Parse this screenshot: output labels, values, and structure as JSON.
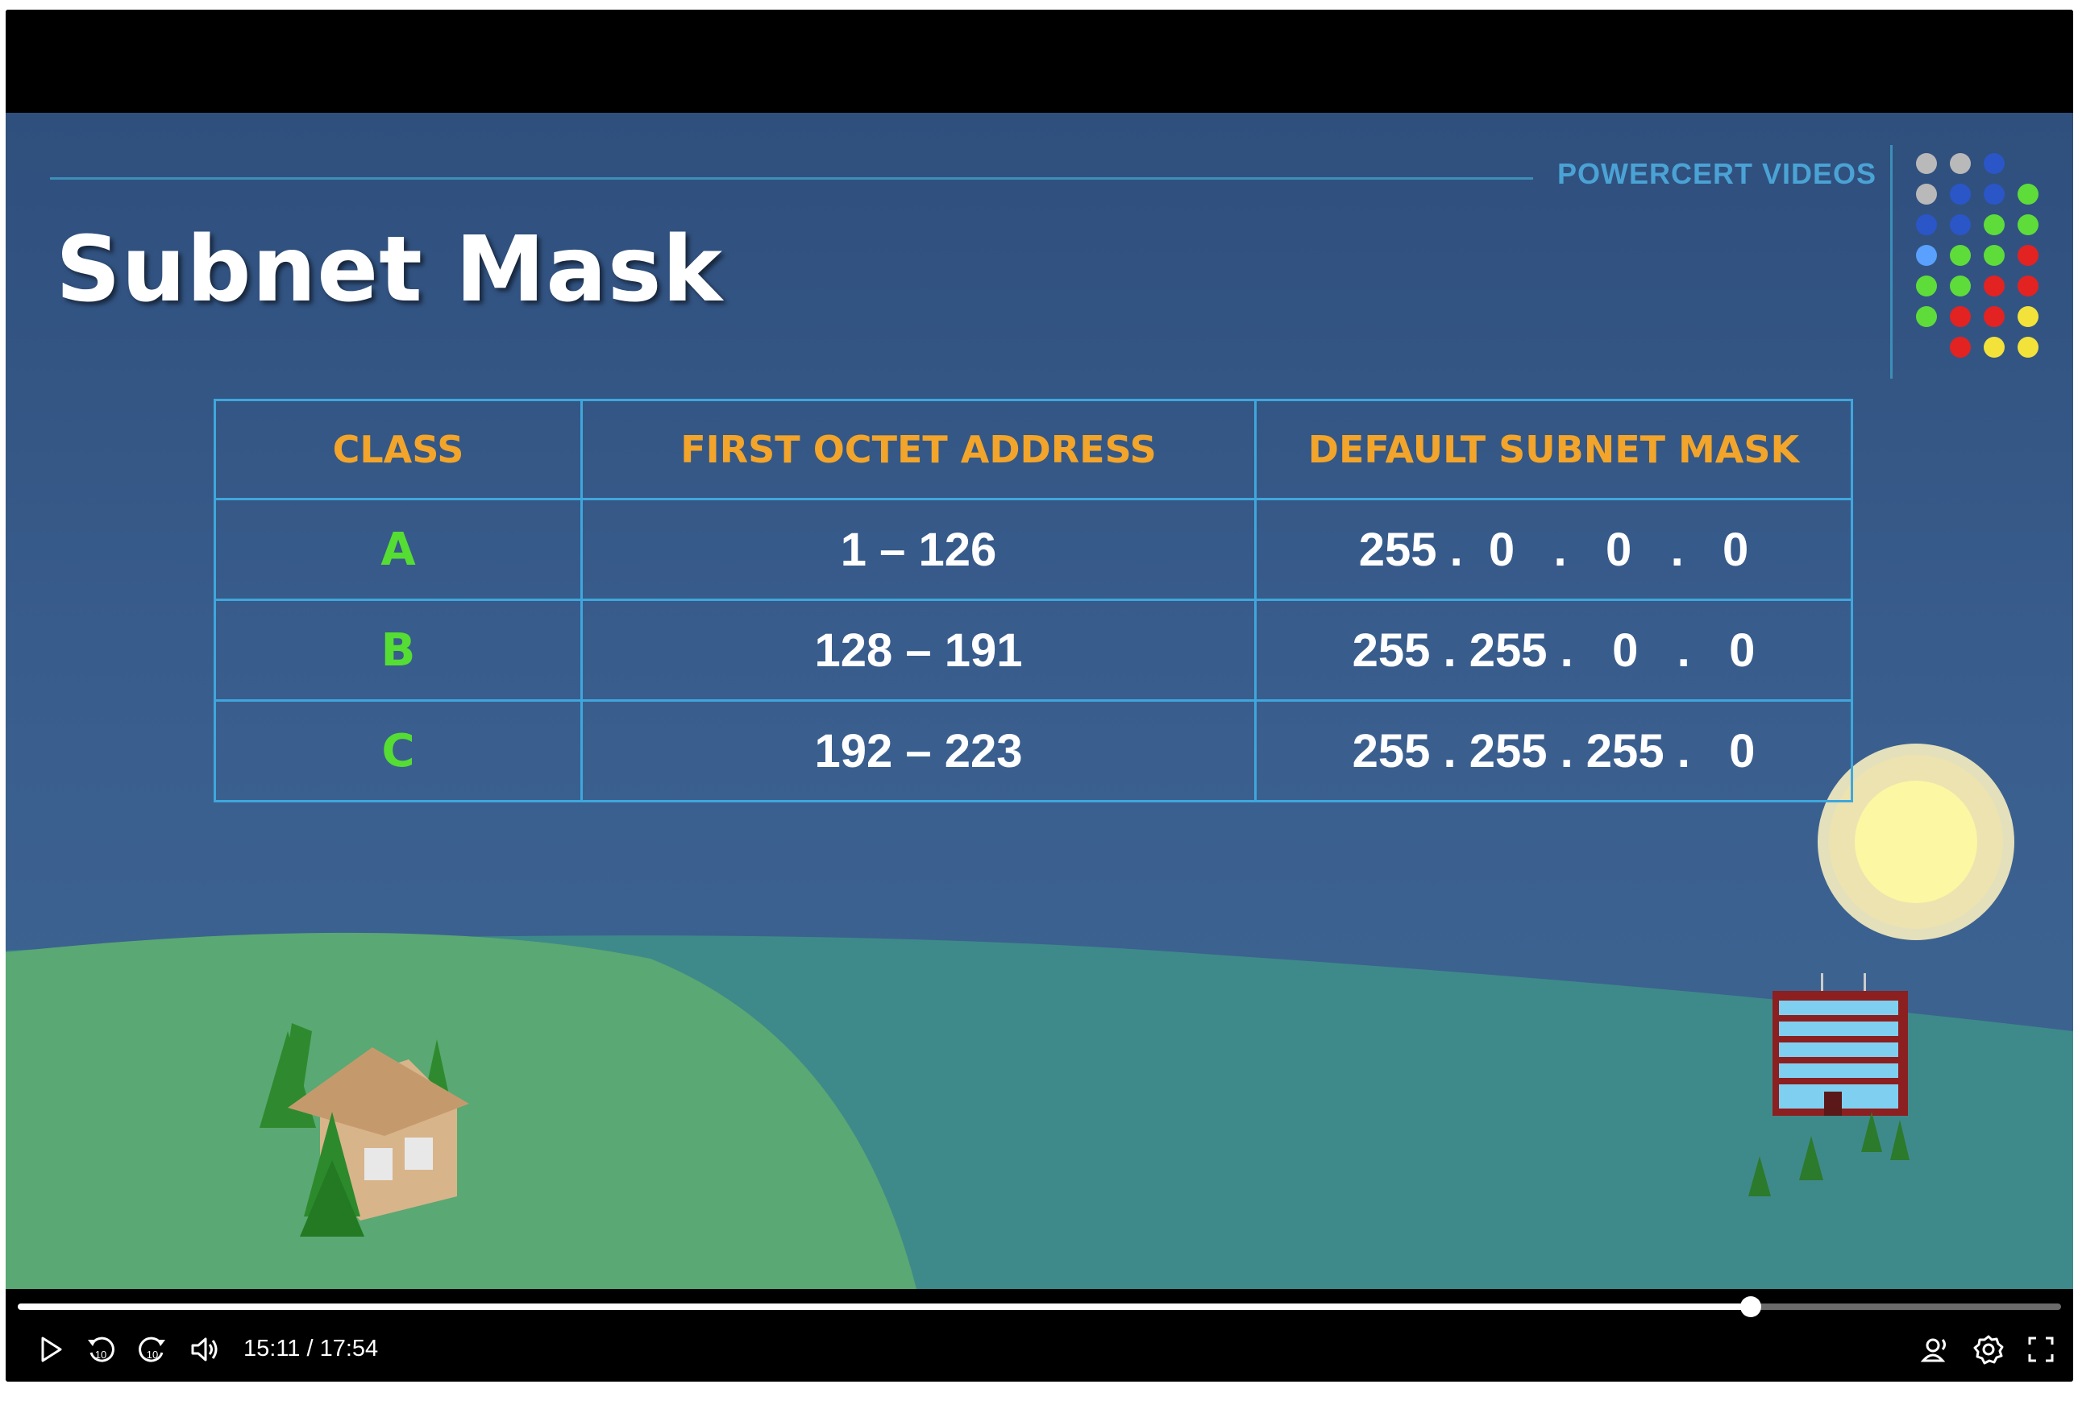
{
  "slide": {
    "brand": "POWERCERT VIDEOS",
    "title": "Subnet Mask"
  },
  "table": {
    "headers": [
      "CLASS",
      "FIRST OCTET ADDRESS",
      "DEFAULT SUBNET MASK"
    ],
    "rows": [
      {
        "class": "A",
        "range": "1 – 126",
        "mask": "255 .  0   .   0   .   0"
      },
      {
        "class": "B",
        "range": "128 – 191",
        "mask": "255 . 255 .   0   .   0"
      },
      {
        "class": "C",
        "range": "192 – 223",
        "mask": "255 . 255 . 255 .   0"
      }
    ]
  },
  "player": {
    "current_time": "15:11",
    "separator": "/",
    "duration": "17:54",
    "time_display": "15:11 / 17:54",
    "progress_fraction": 0.848,
    "rewind_seconds": "10",
    "forward_seconds": "10"
  },
  "colors": {
    "header_text": "#f2a52a",
    "class_text": "#55dd33",
    "table_border": "#3fa7dc",
    "brand_text": "#4aa3d4",
    "background": "#35577f"
  },
  "icons": [
    "play-icon",
    "rewind-10-icon",
    "forward-10-icon",
    "volume-icon",
    "audio-description-icon",
    "settings-gear-icon",
    "fullscreen-icon"
  ]
}
